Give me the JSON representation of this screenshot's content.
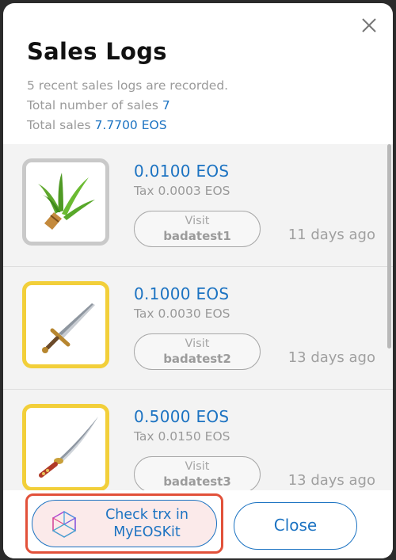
{
  "modal": {
    "title": "Sales Logs",
    "info_line": "5 recent sales logs are recorded.",
    "total_number_label": "Total number of sales",
    "total_number_value": "7",
    "total_sales_label": "Total sales",
    "total_sales_value": "7.7700 EOS"
  },
  "sales": [
    {
      "price": "0.0100 EOS",
      "tax": "Tax 0.0003 EOS",
      "visit_label": "Visit",
      "account": "badatest1",
      "time": "11 days ago",
      "item_icon": "herb-bundle-icon"
    },
    {
      "price": "0.1000 EOS",
      "tax": "Tax 0.0030 EOS",
      "visit_label": "Visit",
      "account": "badatest2",
      "time": "13 days ago",
      "item_icon": "sword-icon"
    },
    {
      "price": "0.5000 EOS",
      "tax": "Tax 0.0150 EOS",
      "visit_label": "Visit",
      "account": "badatest3",
      "time": "13 days ago",
      "item_icon": "katana-icon"
    }
  ],
  "footer": {
    "check_line1": "Check trx in",
    "check_line2": "MyEOSKit",
    "close_label": "Close"
  },
  "colors": {
    "accent": "#1c73c2",
    "highlight": "#e2513a",
    "gold_frame": "#f2cf3a",
    "gray_frame": "#c9c9c9"
  }
}
